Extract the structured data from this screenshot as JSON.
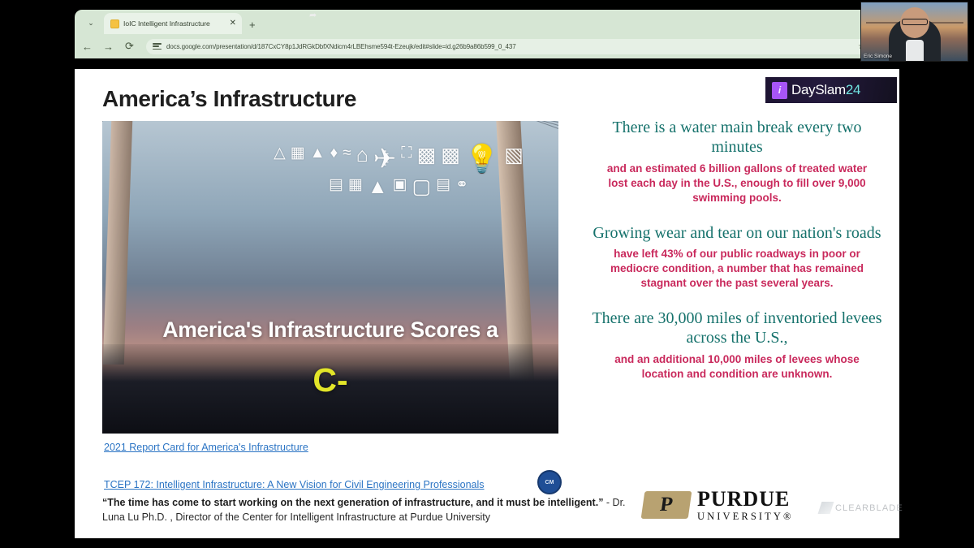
{
  "browser": {
    "tab": {
      "title": "IoIC Intelligent Infrastructure",
      "close_label": "✕",
      "favicon_name": "slides-favicon"
    },
    "new_tab_label": "+",
    "tab_menu_label": "⌄",
    "nav": {
      "back": "←",
      "forward": "→",
      "reload": "⟳"
    },
    "omnibox": {
      "url": "docs.google.com/presentation/d/187CxCY8p1JdRGkDbfXNdicm4rLBEhsme594t-Ezeujk/edit#slide=id.g26b9a86b599_0_437",
      "star": "☆"
    }
  },
  "webcam": {
    "name": "Eric Simone"
  },
  "slide": {
    "title": "America’s Infrastructure",
    "badge": {
      "text": "DaySlam",
      "year": "24",
      "logo_glyph": "i"
    },
    "image": {
      "headline": "America's Infrastructure Scores a",
      "grade": "C-",
      "icons": [
        "⛵",
        "☲",
        "☲",
        "☲",
        "Ὠc",
        "⌂",
        "✈",
        "Ὂ1",
        "⛽",
        "Ὠc",
        "Ὠc",
        "Ὕ1",
        "⚡",
        "Ἶd",
        "Ἶ0",
        "Ὂ7"
      ]
    },
    "links": {
      "report_card": "2021 Report Card for America's Infrastructure",
      "tcep": "TCEP 172: Intelligent Infrastructure: A New Vision for Civil Engineering Professionals"
    },
    "seal_text": "CM",
    "quote": {
      "quoted": "“The time has come to start working on the next generation of infrastructure, and it must be intelligent.”",
      "attribution": " - Dr. Luna Lu Ph.D. , Director of the Center for Intelligent Infrastructure at Purdue University"
    },
    "stats": [
      {
        "headline": "There is a water main break every two minutes",
        "body": "and an estimated 6 billion gallons of treated water lost each day in the U.S., enough to fill over 9,000 swimming pools."
      },
      {
        "headline": "Growing wear and tear on our nation's roads",
        "body": "have left 43% of our public roadways in poor or mediocre condition, a number that has remained stagnant over the past several years."
      },
      {
        "headline": "There are 30,000 miles of inventoried levees across the U.S.,",
        "body": "and an additional 10,000 miles of levees whose location and condition are unknown."
      }
    ],
    "logos": {
      "purdue_mark": "P",
      "purdue_name": "PURDUE",
      "purdue_sub": "UNIVERSITY®",
      "clearblade": "CLEARBLADE"
    }
  },
  "colors": {
    "teal": "#16726c",
    "crimson": "#c9295c",
    "link": "#2b74c4",
    "grade_yellow": "#e2e529",
    "purdue_gold": "#b8a271"
  }
}
